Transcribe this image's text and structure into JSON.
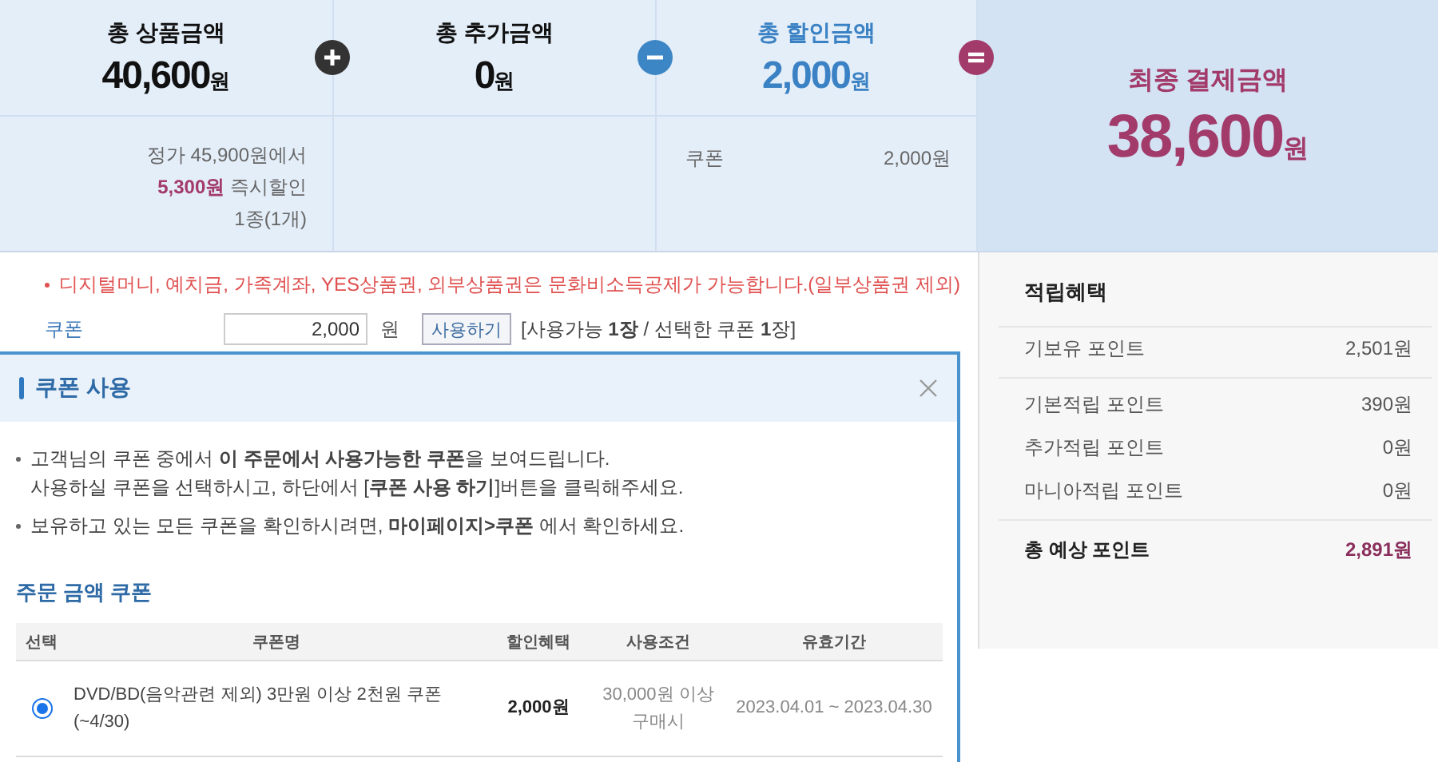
{
  "summary": {
    "items": [
      {
        "kind": "product",
        "label": "총 상품금액",
        "amount": "40,600",
        "unit": "원",
        "operator": {
          "kind": "plus"
        },
        "detail_lines": [
          "정가 45,900원에서",
          "**5,300원** 즉시할인",
          "1종(1개)"
        ]
      },
      {
        "kind": "extra",
        "label": "총 추가금액",
        "amount": "0",
        "unit": "원",
        "operator": {
          "kind": "minus"
        }
      },
      {
        "kind": "discount",
        "label": "총 할인금액",
        "amount": "2,000",
        "unit": "원",
        "operator": {
          "kind": "equals"
        },
        "detail_label": "쿠폰",
        "detail_value": "2,000원"
      }
    ],
    "final": {
      "label": "최종 결제금액",
      "amount": "38,600",
      "unit": "원"
    }
  },
  "notice": "디지털머니, 예치금, 가족계좌, YES상품권, 외부상품권은 문화비소득공제가 가능합니다.(일부상품권 제외)",
  "coupon_row": {
    "label": "쿠폰",
    "value": "2,000",
    "unit": "원",
    "button": "사용하기",
    "status": "[사용가능 **1장** / 선택한 쿠폰 **1**장]"
  },
  "popup": {
    "title": "쿠폰 사용",
    "notes": [
      {
        "lines": [
          "고객님의 쿠폰 중에서 **이 주문에서 사용가능한 쿠폰**을 보여드립니다.",
          "사용하실 쿠폰을 선택하시고, 하단에서 [**쿠폰 사용 하기**]버튼을 클릭해주세요."
        ]
      },
      {
        "lines": [
          "보유하고 있는 모든 쿠폰을 확인하시려면, **마이페이지>쿠폰** 에서 확인하세요."
        ]
      }
    ],
    "section_title": "주문 금액 쿠폰",
    "table": {
      "columns": [
        "선택",
        "쿠폰명",
        "할인혜택",
        "사용조건",
        "유효기간"
      ],
      "rows": [
        {
          "selected": true,
          "name": "DVD/BD(음악관련 제외) 3만원 이상 2천원 쿠폰 (~4/30)",
          "benefit": "2,000원",
          "condition": "30,000원 이상 구매시",
          "period": "2023.04.01 ~ 2023.04.30"
        }
      ]
    }
  },
  "points": {
    "title": "적립혜택",
    "rows": [
      {
        "label": "기보유 포인트",
        "value": "2,501원"
      },
      {
        "label": "기본적립 포인트",
        "value": "390원"
      },
      {
        "label": "추가적립 포인트",
        "value": "0원"
      },
      {
        "label": "마니아적립 포인트",
        "value": "0원"
      }
    ],
    "total": {
      "label": "총 예상 포인트",
      "value": "2,891원"
    }
  }
}
